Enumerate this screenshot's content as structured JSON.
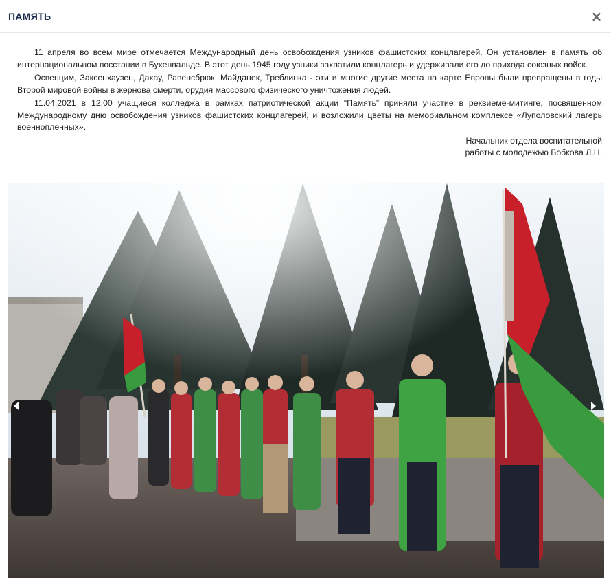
{
  "header": {
    "title": "ПАМЯТЬ",
    "close_symbol": "×"
  },
  "article": {
    "paragraphs": [
      "11 апреля во всем мире отмечается Международный день освобождения узников фашистских концлагерей. Он установлен в память об интернациональном восстании в Бухенвальде. В этот день 1945 году узники захватили концлагерь и удерживали его до прихода союзных войск.",
      "Освенцим, Заксенхаузен, Дахау, Равенсбрюк, Майданек, Треблинка - эти и многие другие места на карте Европы были превращены в годы Второй мировой войны в жернова смерти, орудия массового физического уничтожения людей.",
      "11.04.2021 в 12.00 учащиеся колледжа в рамках патриотической акции “Память” приняли участие в реквиеме-митинге, посвященном Международному дню освобождения узников фашистских концлагерей, и возложили цветы на мемориальном комплексе «Луполовский лагерь военнопленных»."
    ],
    "signature_line1": "Начальник отдела воспитательной",
    "signature_line2": "работы с молодежью Бобкова Л.Н."
  },
  "gallery": {
    "prev_icon": "chevron-left-icon",
    "next_icon": "chevron-right-icon"
  },
  "colors": {
    "title": "#1f2d4f",
    "flag_red": "#c8202a",
    "flag_green": "#3a9a3e"
  }
}
